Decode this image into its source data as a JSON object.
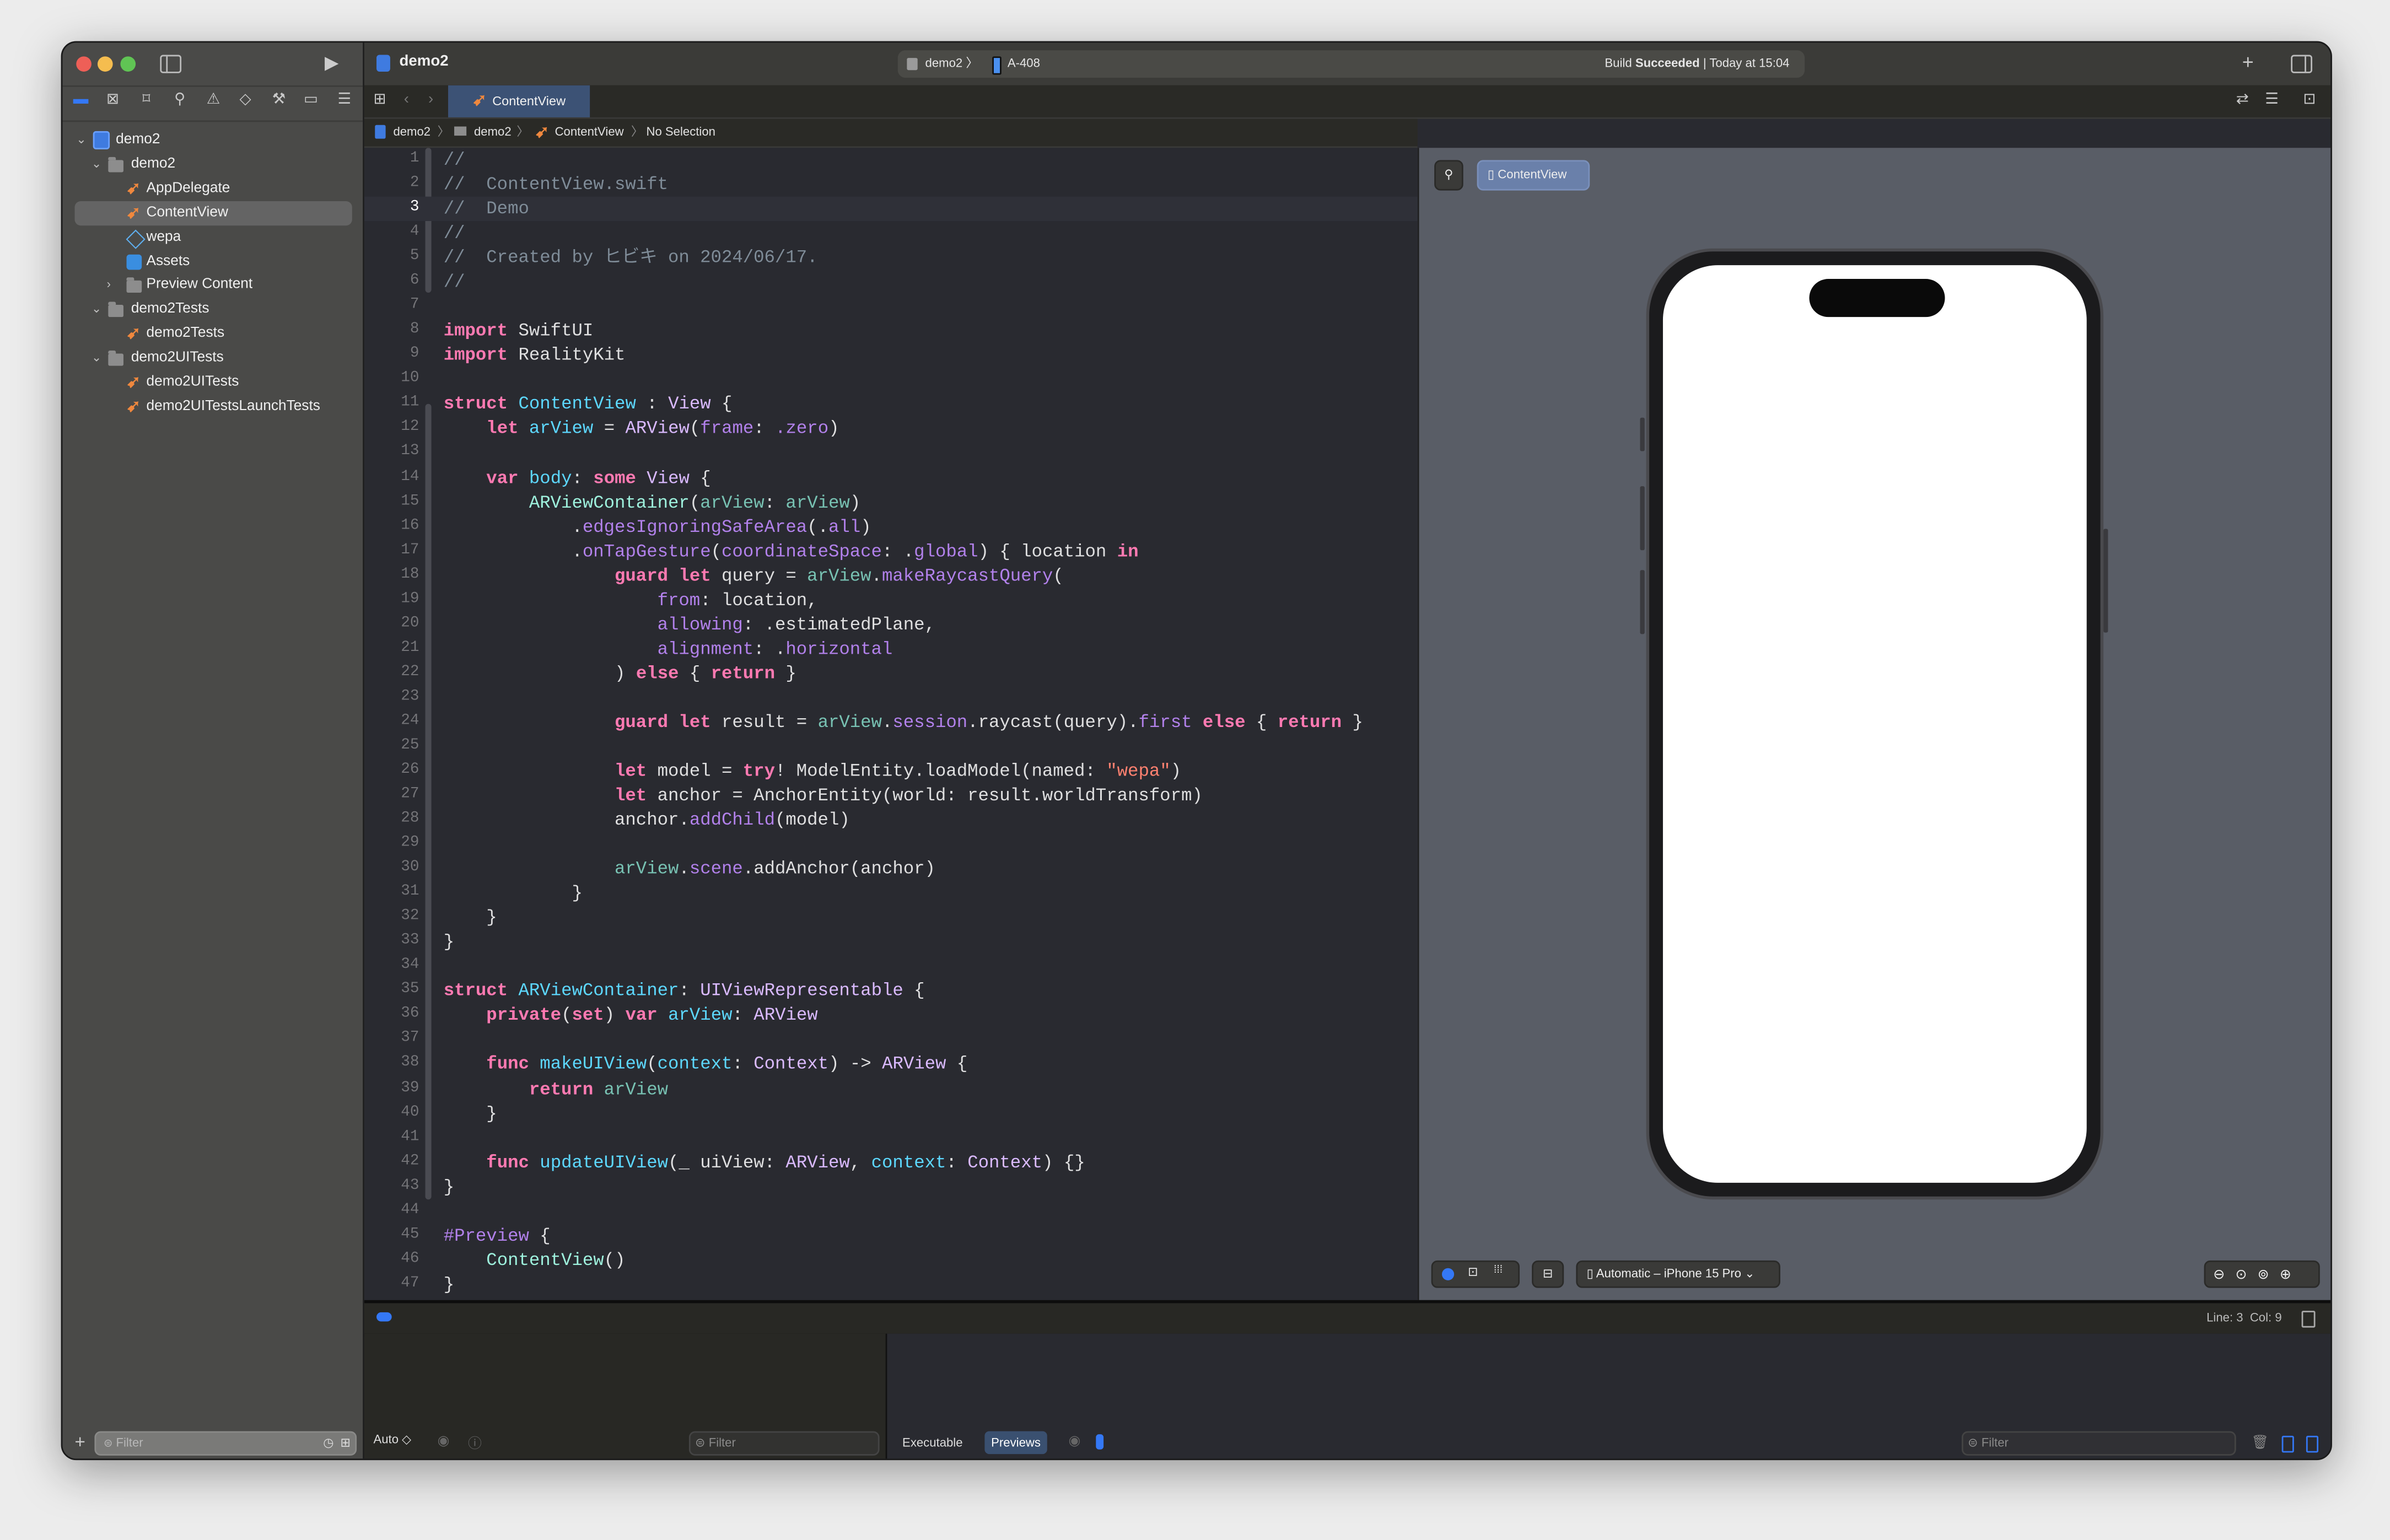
{
  "colors": {
    "accent": "#3478f6",
    "close": "#ee5f57",
    "minimize": "#f5bd4f",
    "zoom": "#60c454",
    "tab_active": "#3c5275",
    "selection": "#646464"
  },
  "titlebar": {
    "project": "demo2",
    "scheme": "demo2",
    "device": "A-408",
    "build_status_prefix": "Build",
    "build_status": "Succeeded",
    "build_time": "| Today at 15:04"
  },
  "navigator": {
    "icons": [
      "folder-icon",
      "source-control-icon",
      "bookmark-icon",
      "search-icon",
      "warning-icon",
      "test-icon",
      "debug-icon",
      "breakpoint-icon",
      "report-icon"
    ],
    "tree": [
      {
        "label": "demo2",
        "icon": "xcodeproj",
        "chevron": "open",
        "level": 0
      },
      {
        "label": "demo2",
        "icon": "folder",
        "chevron": "open",
        "level": 1
      },
      {
        "label": "AppDelegate",
        "icon": "swift",
        "chevron": "none",
        "level": 2
      },
      {
        "label": "ContentView",
        "icon": "swift",
        "chevron": "none",
        "level": 2,
        "selected": true
      },
      {
        "label": "wepa",
        "icon": "usdz",
        "chevron": "none",
        "level": 2
      },
      {
        "label": "Assets",
        "icon": "assets",
        "chevron": "none",
        "level": 2
      },
      {
        "label": "Preview Content",
        "icon": "folder",
        "chevron": "closed",
        "level": 2
      },
      {
        "label": "demo2Tests",
        "icon": "folder",
        "chevron": "open",
        "level": 1
      },
      {
        "label": "demo2Tests",
        "icon": "swift",
        "chevron": "none",
        "level": 2
      },
      {
        "label": "demo2UITests",
        "icon": "folder",
        "chevron": "open",
        "level": 1
      },
      {
        "label": "demo2UITests",
        "icon": "swift",
        "chevron": "none",
        "level": 2
      },
      {
        "label": "demo2UITestsLaunchTests",
        "icon": "swift",
        "chevron": "none",
        "level": 2
      }
    ],
    "filter_placeholder": "Filter"
  },
  "editor": {
    "tab": "ContentView",
    "breadcrumb": [
      "demo2",
      "demo2",
      "ContentView",
      "No Selection"
    ],
    "current_line": 3,
    "lines": [
      [
        [
          "//",
          "c"
        ]
      ],
      [
        [
          "//  ContentView.swift",
          "c"
        ]
      ],
      [
        [
          "//  Demo",
          "c"
        ]
      ],
      [
        [
          "//",
          "c"
        ]
      ],
      [
        [
          "//  Created by ヒビキ on 2024/06/17.",
          "c"
        ]
      ],
      [
        [
          "//",
          "c"
        ]
      ],
      [],
      [
        [
          "import",
          "k"
        ],
        [
          " SwiftUI",
          "p"
        ]
      ],
      [
        [
          "import",
          "k"
        ],
        [
          " RealityKit",
          "p"
        ]
      ],
      [],
      [
        [
          "struct",
          "k"
        ],
        [
          " ",
          "p"
        ],
        [
          "ContentView",
          "d"
        ],
        [
          " : ",
          "p"
        ],
        [
          "View",
          "t"
        ],
        [
          " {",
          "p"
        ]
      ],
      [
        [
          "    ",
          "p"
        ],
        [
          "let",
          "k"
        ],
        [
          " ",
          "p"
        ],
        [
          "arView",
          "d"
        ],
        [
          " = ",
          "p"
        ],
        [
          "ARView",
          "t"
        ],
        [
          "(",
          "p"
        ],
        [
          "frame",
          "m"
        ],
        [
          ": ",
          "p"
        ],
        [
          ".zero",
          "m"
        ],
        [
          ")",
          "p"
        ]
      ],
      [],
      [
        [
          "    ",
          "p"
        ],
        [
          "var",
          "k"
        ],
        [
          " ",
          "p"
        ],
        [
          "body",
          "d"
        ],
        [
          ": ",
          "p"
        ],
        [
          "some",
          "k"
        ],
        [
          " ",
          "p"
        ],
        [
          "View",
          "t"
        ],
        [
          " {",
          "p"
        ]
      ],
      [
        [
          "        ",
          "p"
        ],
        [
          "ARViewContainer",
          "pt"
        ],
        [
          "(",
          "p"
        ],
        [
          "arView",
          "pv"
        ],
        [
          ": ",
          "p"
        ],
        [
          "arView",
          "pv"
        ],
        [
          ")",
          "p"
        ]
      ],
      [
        [
          "            .",
          "p"
        ],
        [
          "edgesIgnoringSafeArea",
          "m"
        ],
        [
          "(.",
          "p"
        ],
        [
          "all",
          "m"
        ],
        [
          ")",
          "p"
        ]
      ],
      [
        [
          "            .",
          "p"
        ],
        [
          "onTapGesture",
          "m"
        ],
        [
          "(",
          "p"
        ],
        [
          "coordinateSpace",
          "m"
        ],
        [
          ": .",
          "p"
        ],
        [
          "global",
          "m"
        ],
        [
          ") { location ",
          "p"
        ],
        [
          "in",
          "k"
        ]
      ],
      [
        [
          "                ",
          "p"
        ],
        [
          "guard",
          "k"
        ],
        [
          " ",
          "p"
        ],
        [
          "let",
          "k"
        ],
        [
          " query = ",
          "p"
        ],
        [
          "arView",
          "pv"
        ],
        [
          ".",
          "p"
        ],
        [
          "makeRaycastQuery",
          "m"
        ],
        [
          "(",
          "p"
        ]
      ],
      [
        [
          "                    ",
          "p"
        ],
        [
          "from",
          "m"
        ],
        [
          ": location,",
          "p"
        ]
      ],
      [
        [
          "                    ",
          "p"
        ],
        [
          "allowing",
          "m"
        ],
        [
          ": .estimatedPlane,",
          "p"
        ]
      ],
      [
        [
          "                    ",
          "p"
        ],
        [
          "alignment",
          "m"
        ],
        [
          ": .",
          "p"
        ],
        [
          "horizontal",
          "m"
        ]
      ],
      [
        [
          "                ) ",
          "p"
        ],
        [
          "else",
          "k"
        ],
        [
          " { ",
          "p"
        ],
        [
          "return",
          "k"
        ],
        [
          " }",
          "p"
        ]
      ],
      [],
      [
        [
          "                ",
          "p"
        ],
        [
          "guard",
          "k"
        ],
        [
          " ",
          "p"
        ],
        [
          "let",
          "k"
        ],
        [
          " result = ",
          "p"
        ],
        [
          "arView",
          "pv"
        ],
        [
          ".",
          "p"
        ],
        [
          "session",
          "m"
        ],
        [
          ".raycast(query).",
          "p"
        ],
        [
          "first",
          "m"
        ],
        [
          " ",
          "p"
        ],
        [
          "else",
          "k"
        ],
        [
          " { ",
          "p"
        ],
        [
          "return",
          "k"
        ],
        [
          " }",
          "p"
        ]
      ],
      [],
      [
        [
          "                ",
          "p"
        ],
        [
          "let",
          "k"
        ],
        [
          " model = ",
          "p"
        ],
        [
          "try",
          "k"
        ],
        [
          "! ModelEntity.loadModel(named: ",
          "p"
        ],
        [
          "\"wepa\"",
          "s"
        ],
        [
          ")",
          "p"
        ]
      ],
      [
        [
          "                ",
          "p"
        ],
        [
          "let",
          "k"
        ],
        [
          " anchor = AnchorEntity(world: result.worldTransform)",
          "p"
        ]
      ],
      [
        [
          "                anchor.",
          "p"
        ],
        [
          "addChild",
          "m"
        ],
        [
          "(model)",
          "p"
        ]
      ],
      [],
      [
        [
          "                ",
          "p"
        ],
        [
          "arView",
          "pv"
        ],
        [
          ".",
          "p"
        ],
        [
          "scene",
          "m"
        ],
        [
          ".addAnchor(anchor)",
          "p"
        ]
      ],
      [
        [
          "            }",
          "p"
        ]
      ],
      [
        [
          "    }",
          "p"
        ]
      ],
      [
        [
          "}",
          "p"
        ]
      ],
      [],
      [
        [
          "struct",
          "k"
        ],
        [
          " ",
          "p"
        ],
        [
          "ARViewContainer",
          "d"
        ],
        [
          ": ",
          "p"
        ],
        [
          "UIViewRepresentable",
          "t"
        ],
        [
          " {",
          "p"
        ]
      ],
      [
        [
          "    ",
          "p"
        ],
        [
          "private",
          "k"
        ],
        [
          "(",
          "p"
        ],
        [
          "set",
          "k"
        ],
        [
          ") ",
          "p"
        ],
        [
          "var",
          "k"
        ],
        [
          " ",
          "p"
        ],
        [
          "arView",
          "d"
        ],
        [
          ": ",
          "p"
        ],
        [
          "ARView",
          "t"
        ]
      ],
      [],
      [
        [
          "    ",
          "p"
        ],
        [
          "func",
          "k"
        ],
        [
          " ",
          "p"
        ],
        [
          "makeUIView",
          "d"
        ],
        [
          "(",
          "p"
        ],
        [
          "context",
          "d"
        ],
        [
          ": ",
          "p"
        ],
        [
          "Context",
          "t"
        ],
        [
          ") -> ",
          "p"
        ],
        [
          "ARView",
          "t"
        ],
        [
          " {",
          "p"
        ]
      ],
      [
        [
          "        ",
          "p"
        ],
        [
          "return",
          "k"
        ],
        [
          " ",
          "p"
        ],
        [
          "arView",
          "pv"
        ]
      ],
      [
        [
          "    }",
          "p"
        ]
      ],
      [],
      [
        [
          "    ",
          "p"
        ],
        [
          "func",
          "k"
        ],
        [
          " ",
          "p"
        ],
        [
          "updateUIView",
          "d"
        ],
        [
          "(_ uiView: ",
          "p"
        ],
        [
          "ARView",
          "t"
        ],
        [
          ", ",
          "p"
        ],
        [
          "context",
          "d"
        ],
        [
          ": ",
          "p"
        ],
        [
          "Context",
          "t"
        ],
        [
          ") {}",
          "p"
        ]
      ],
      [
        [
          "}",
          "p"
        ]
      ],
      [],
      [
        [
          "#Preview",
          "pre"
        ],
        [
          " {",
          "p"
        ]
      ],
      [
        [
          "    ",
          "p"
        ],
        [
          "ContentView",
          "pt"
        ],
        [
          "()",
          "p"
        ]
      ],
      [
        [
          "}",
          "p"
        ]
      ]
    ]
  },
  "preview": {
    "chip": "ContentView",
    "device_selector": "Automatic – iPhone 15 Pro"
  },
  "statusbar": {
    "cursor": "Line: 3  Col: 9"
  },
  "debug": {
    "mode": "Auto ◇",
    "filter_placeholder": "Filter",
    "tabs": [
      "Executable",
      "Previews"
    ],
    "active_tab": "Previews",
    "console_filter_placeholder": "Filter"
  }
}
